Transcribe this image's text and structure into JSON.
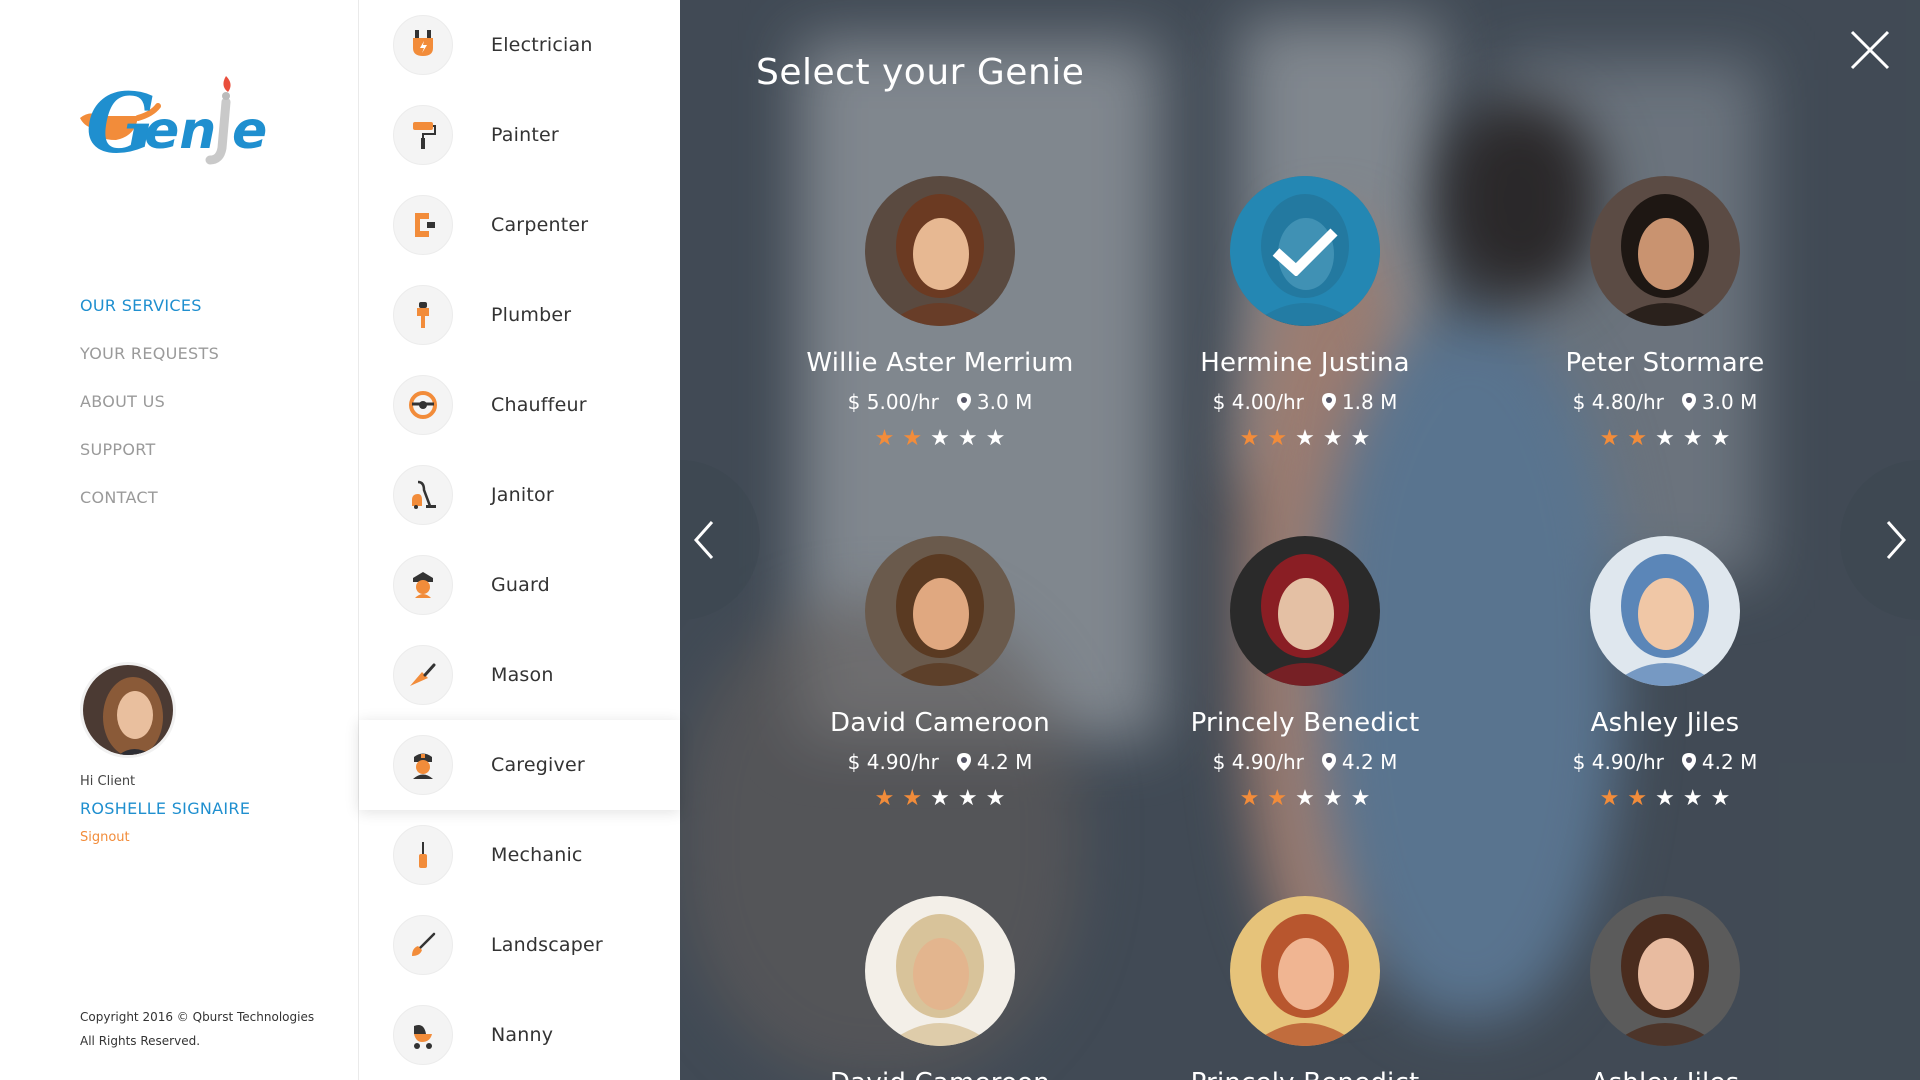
{
  "brand": {
    "logo_text": "Genie",
    "primary": "#1f8fcf",
    "accent": "#f28c3a"
  },
  "menu": [
    {
      "label": "OUR SERVICES",
      "active": true
    },
    {
      "label": "YOUR REQUESTS",
      "active": false
    },
    {
      "label": "ABOUT US",
      "active": false
    },
    {
      "label": "SUPPORT",
      "active": false
    },
    {
      "label": "CONTACT",
      "active": false
    }
  ],
  "user": {
    "greeting": "Hi Client",
    "name": "ROSHELLE SIGNAIRE",
    "signout": "Signout"
  },
  "footer": {
    "line1": "Copyright 2016 © Qburst Technologies",
    "line2": "All Rights Reserved."
  },
  "services": [
    {
      "label": "Electrician",
      "icon": "plug-icon"
    },
    {
      "label": "Painter",
      "icon": "paint-roller-icon"
    },
    {
      "label": "Carpenter",
      "icon": "clamp-icon"
    },
    {
      "label": "Plumber",
      "icon": "faucet-icon"
    },
    {
      "label": "Chauffeur",
      "icon": "steering-wheel-icon"
    },
    {
      "label": "Janitor",
      "icon": "vacuum-icon"
    },
    {
      "label": "Guard",
      "icon": "guard-icon"
    },
    {
      "label": "Mason",
      "icon": "trowel-icon"
    },
    {
      "label": "Caregiver",
      "icon": "nurse-icon",
      "selected": true
    },
    {
      "label": "Mechanic",
      "icon": "screwdriver-icon"
    },
    {
      "label": "Landscaper",
      "icon": "shovel-icon"
    },
    {
      "label": "Nanny",
      "icon": "stroller-icon"
    }
  ],
  "panel": {
    "title": "Select your Genie",
    "close_icon": "close-icon",
    "prev_icon": "chevron-left-icon",
    "next_icon": "chevron-right-icon"
  },
  "genies": [
    {
      "name": "Willie Aster Merrium",
      "rate": "$ 5.00/hr",
      "distance": "3.0 M",
      "rating": 2,
      "selected": false,
      "skin": "#e7b892",
      "hair": "#6b3a22",
      "bg": "#5a4a40"
    },
    {
      "name": "Hermine Justina",
      "rate": "$ 4.00/hr",
      "distance": "1.8 M",
      "rating": 2,
      "selected": true,
      "skin": "#d7a583",
      "hair": "#3a2418",
      "bg": "#3f6f7e"
    },
    {
      "name": "Peter Stormare",
      "rate": "$ 4.80/hr",
      "distance": "3.0 M",
      "rating": 2,
      "selected": false,
      "skin": "#c99370",
      "hair": "#1e1713",
      "bg": "#5b4b44"
    },
    {
      "name": "David Cameroon",
      "rate": "$ 4.90/hr",
      "distance": "4.2 M",
      "rating": 2,
      "selected": false,
      "skin": "#e0a880",
      "hair": "#5a3a22",
      "bg": "#6a5a4c"
    },
    {
      "name": "Princely Benedict",
      "rate": "$ 4.90/hr",
      "distance": "4.2 M",
      "rating": 2,
      "selected": false,
      "skin": "#e4c0a4",
      "hair": "#8a1e24",
      "bg": "#2a2a2a"
    },
    {
      "name": "Ashley Jiles",
      "rate": "$ 4.90/hr",
      "distance": "4.2 M",
      "rating": 2,
      "selected": false,
      "skin": "#f0c7a6",
      "hair": "#5b86b8",
      "bg": "#dfe7ee"
    },
    {
      "name": "David Cameroon",
      "rate": "",
      "distance": "",
      "rating": 0,
      "selected": false,
      "skin": "#e3b58e",
      "hair": "#d8c39a",
      "bg": "#f3efe8"
    },
    {
      "name": "Princely Benedict",
      "rate": "",
      "distance": "",
      "rating": 0,
      "selected": false,
      "skin": "#f0b592",
      "hair": "#b8562e",
      "bg": "#e6c37a"
    },
    {
      "name": "Ashley Jiles",
      "rate": "",
      "distance": "",
      "rating": 0,
      "selected": false,
      "skin": "#e8bba0",
      "hair": "#4a2c1e",
      "bg": "#5b5b5b"
    }
  ]
}
